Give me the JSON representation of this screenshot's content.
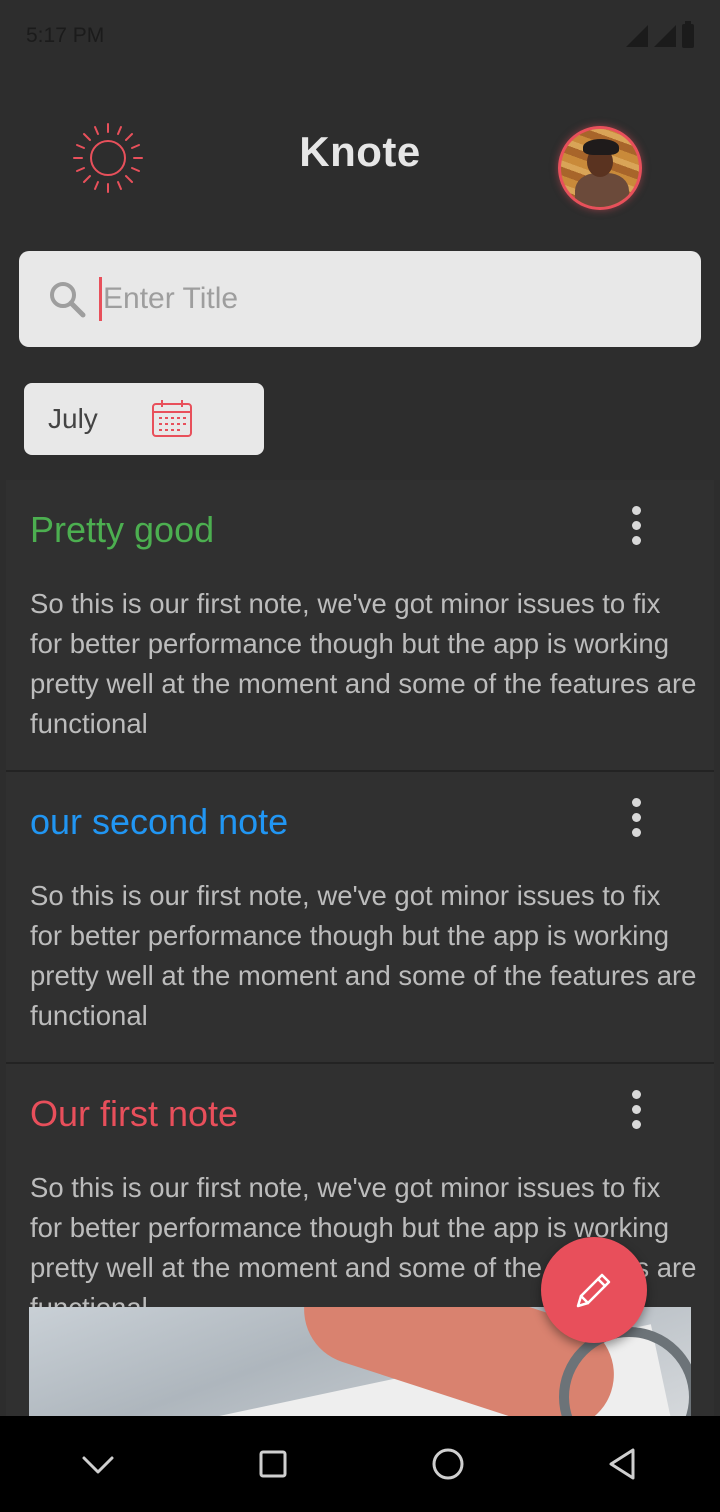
{
  "status_bar": {
    "time": "5:17 PM"
  },
  "header": {
    "title": "Knote",
    "theme_toggle_icon": "sun-icon",
    "avatar_icon": "user-avatar"
  },
  "search": {
    "placeholder": "Enter Title",
    "icon": "search-icon"
  },
  "month_filter": {
    "label": "July",
    "icon": "calendar-icon"
  },
  "notes": [
    {
      "title": "Pretty good",
      "title_color": "#4caf50",
      "body": "So this is our first note, we've got minor issues to fix for better performance though but the app is working pretty well at the moment and some of the features are functional"
    },
    {
      "title": "our second note",
      "title_color": "#2196f3",
      "body": "So this is our first note, we've got minor issues to fix for better performance though but the app is working pretty well at the moment and some of the features are functional"
    },
    {
      "title": "Our first note",
      "title_color": "#e84f5b",
      "body": "So this is our first note, we've got minor issues to fix for better performance though but the app is working pretty well at the moment and some of the features are functional"
    }
  ],
  "fab": {
    "icon": "pencil-icon",
    "color": "#e84f5b"
  },
  "colors": {
    "accent": "#e84f5b",
    "background": "#2d2d2d",
    "card": "#303030"
  },
  "nav_bar": {
    "icons": [
      "chevron-down-icon",
      "square-icon",
      "circle-icon",
      "triangle-back-icon"
    ]
  }
}
